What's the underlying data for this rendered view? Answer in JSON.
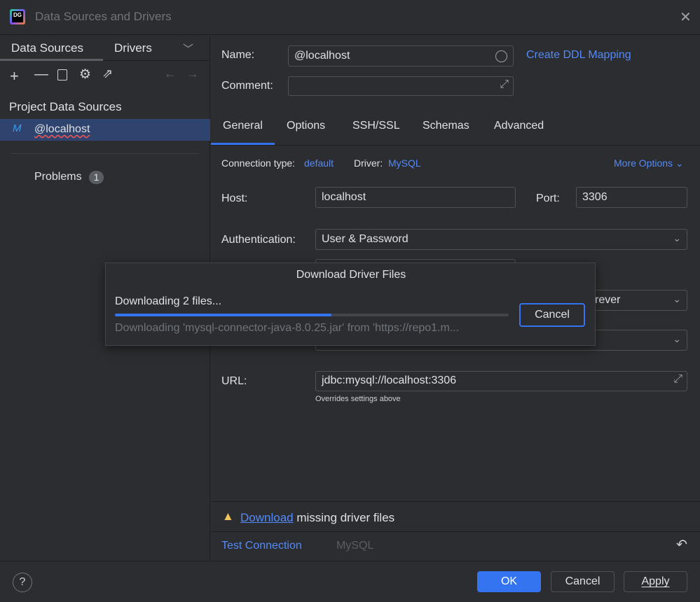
{
  "window": {
    "title": "Data Sources and Drivers",
    "logo": "DG"
  },
  "sidebar": {
    "tabs": [
      "Data Sources",
      "Drivers"
    ],
    "section": "Project Data Sources",
    "items": [
      {
        "label": "@localhost",
        "icon": "mysql-icon"
      }
    ],
    "problems_label": "Problems",
    "problems_count": "1"
  },
  "form": {
    "name_label": "Name:",
    "name_value": "@localhost",
    "ddl_link": "Create DDL Mapping",
    "comment_label": "Comment:",
    "comment_value": "",
    "tabs": [
      "General",
      "Options",
      "SSH/SSL",
      "Schemas",
      "Advanced"
    ],
    "active_tab": "General",
    "conn_type_label": "Connection type:",
    "conn_type_value": "default",
    "driver_label": "Driver:",
    "driver_value": "MySQL",
    "more_options": "More Options",
    "host_label": "Host:",
    "host_value": "localhost",
    "port_label": "Port:",
    "port_value": "3306",
    "auth_label": "Authentication:",
    "auth_value": "User & Password",
    "save_partial": "rever",
    "url_label": "URL:",
    "url_value": "jdbc:mysql://localhost:3306",
    "url_hint": "Overrides settings above"
  },
  "warning": {
    "link": "Download",
    "text": "missing driver files"
  },
  "footer": {
    "test_connection": "Test Connection",
    "driver_name": "MySQL"
  },
  "buttons": {
    "ok": "OK",
    "cancel": "Cancel",
    "apply": "Apply"
  },
  "download_popup": {
    "title": "Download Driver Files",
    "status": "Downloading 2 files...",
    "progress_percent": 55,
    "detail": "Downloading 'mysql-connector-java-8.0.25.jar' from 'https://repo1.m...",
    "cancel": "Cancel"
  },
  "colors": {
    "accent": "#548af7",
    "primary_button": "#3574f0",
    "selection": "#2e436e",
    "warning": "#f2c55c"
  }
}
